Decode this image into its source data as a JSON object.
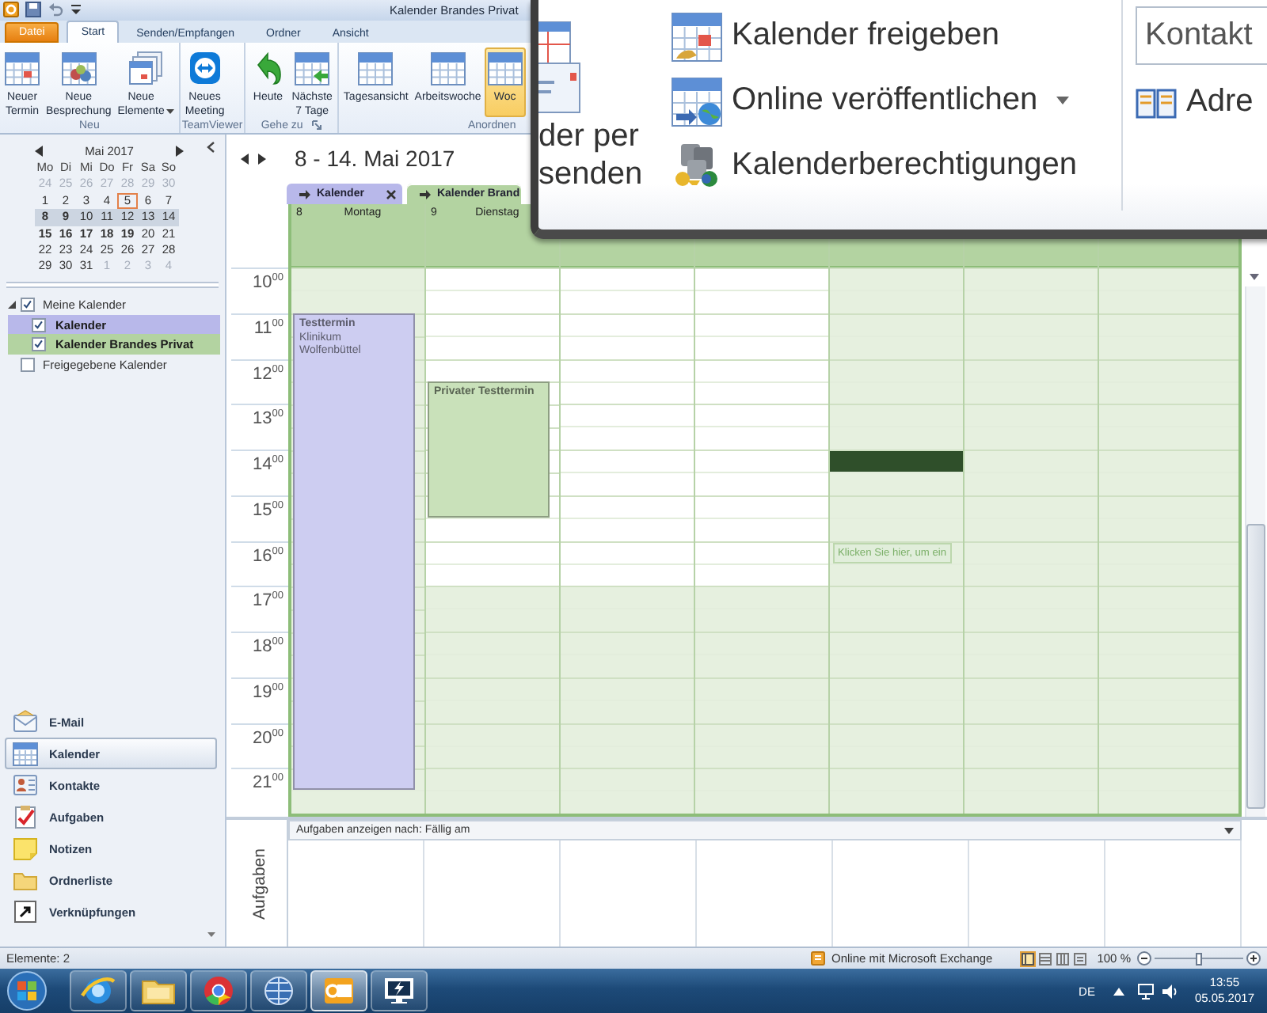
{
  "window": {
    "title": "Kalender Brandes Privat"
  },
  "ribbon_tabs": [
    {
      "label": "Datei",
      "kind": "file",
      "selected": false
    },
    {
      "label": "Start",
      "kind": "tab",
      "selected": true
    },
    {
      "label": "Senden/Empfangen",
      "kind": "tab",
      "selected": false
    },
    {
      "label": "Ordner",
      "kind": "tab",
      "selected": false
    },
    {
      "label": "Ansicht",
      "kind": "tab",
      "selected": false
    }
  ],
  "ribbon_groups": [
    {
      "label": "Neu",
      "launcher": false,
      "buttons": [
        {
          "kind": "new-appointment",
          "lines": [
            "Neuer",
            "Termin"
          ],
          "dropdown": false,
          "selected": false
        },
        {
          "kind": "new-meeting",
          "lines": [
            "Neue",
            "Besprechung"
          ],
          "dropdown": false,
          "selected": false
        },
        {
          "kind": "new-items",
          "lines": [
            "Neue",
            "Elemente"
          ],
          "dropdown": true,
          "selected": false
        }
      ]
    },
    {
      "label": "TeamViewer",
      "launcher": false,
      "buttons": [
        {
          "kind": "teamviewer-meeting",
          "lines": [
            "Neues",
            "Meeting"
          ],
          "dropdown": false,
          "selected": false
        }
      ]
    },
    {
      "label": "Gehe zu",
      "launcher": true,
      "buttons": [
        {
          "kind": "today",
          "lines": [
            "Heute"
          ],
          "dropdown": false,
          "selected": false
        },
        {
          "kind": "next-7-days",
          "lines": [
            "Nächste",
            "7 Tage"
          ],
          "dropdown": false,
          "selected": false
        }
      ]
    },
    {
      "label": "Anordnen",
      "launcher": false,
      "buttons": [
        {
          "kind": "day-view",
          "lines": [
            "Tagesansicht"
          ],
          "dropdown": false,
          "selected": false
        },
        {
          "kind": "work-week-view",
          "lines": [
            "Arbeitswoche"
          ],
          "dropdown": false,
          "selected": false
        },
        {
          "kind": "week-view",
          "lines": [
            "Woc"
          ],
          "dropdown": false,
          "selected": true
        }
      ]
    }
  ],
  "mini_calendar": {
    "month": "Mai 2017",
    "weekdays": [
      "Mo",
      "Di",
      "Mi",
      "Do",
      "Fr",
      "Sa",
      "So"
    ],
    "weeks": [
      {
        "selected": false,
        "days": [
          {
            "label": "24",
            "other_month": true,
            "bold": false,
            "today": false
          },
          {
            "label": "25",
            "other_month": true,
            "bold": false,
            "today": false
          },
          {
            "label": "26",
            "other_month": true,
            "bold": false,
            "today": false
          },
          {
            "label": "27",
            "other_month": true,
            "bold": false,
            "today": false
          },
          {
            "label": "28",
            "other_month": true,
            "bold": false,
            "today": false
          },
          {
            "label": "29",
            "other_month": true,
            "bold": false,
            "today": false
          },
          {
            "label": "30",
            "other_month": true,
            "bold": false,
            "today": false
          }
        ]
      },
      {
        "selected": false,
        "days": [
          {
            "label": "1",
            "other_month": false,
            "bold": false,
            "today": false
          },
          {
            "label": "2",
            "other_month": false,
            "bold": false,
            "today": false
          },
          {
            "label": "3",
            "other_month": false,
            "bold": false,
            "today": false
          },
          {
            "label": "4",
            "other_month": false,
            "bold": false,
            "today": false
          },
          {
            "label": "5",
            "other_month": false,
            "bold": false,
            "today": true
          },
          {
            "label": "6",
            "other_month": false,
            "bold": false,
            "today": false
          },
          {
            "label": "7",
            "other_month": false,
            "bold": false,
            "today": false
          }
        ]
      },
      {
        "selected": true,
        "days": [
          {
            "label": "8",
            "other_month": false,
            "bold": true,
            "today": false
          },
          {
            "label": "9",
            "other_month": false,
            "bold": true,
            "today": false
          },
          {
            "label": "10",
            "other_month": false,
            "bold": false,
            "today": false
          },
          {
            "label": "11",
            "other_month": false,
            "bold": false,
            "today": false
          },
          {
            "label": "12",
            "other_month": false,
            "bold": false,
            "today": false
          },
          {
            "label": "13",
            "other_month": false,
            "bold": false,
            "today": false
          },
          {
            "label": "14",
            "other_month": false,
            "bold": false,
            "today": false
          }
        ]
      },
      {
        "selected": false,
        "days": [
          {
            "label": "15",
            "other_month": false,
            "bold": true,
            "today": false
          },
          {
            "label": "16",
            "other_month": false,
            "bold": true,
            "today": false
          },
          {
            "label": "17",
            "other_month": false,
            "bold": true,
            "today": false
          },
          {
            "label": "18",
            "other_month": false,
            "bold": true,
            "today": false
          },
          {
            "label": "19",
            "other_month": false,
            "bold": true,
            "today": false
          },
          {
            "label": "20",
            "other_month": false,
            "bold": false,
            "today": false
          },
          {
            "label": "21",
            "other_month": false,
            "bold": false,
            "today": false
          }
        ]
      },
      {
        "selected": false,
        "days": [
          {
            "label": "22",
            "other_month": false,
            "bold": false,
            "today": false
          },
          {
            "label": "23",
            "other_month": false,
            "bold": false,
            "today": false
          },
          {
            "label": "24",
            "other_month": false,
            "bold": false,
            "today": false
          },
          {
            "label": "25",
            "other_month": false,
            "bold": false,
            "today": false
          },
          {
            "label": "26",
            "other_month": false,
            "bold": false,
            "today": false
          },
          {
            "label": "27",
            "other_month": false,
            "bold": false,
            "today": false
          },
          {
            "label": "28",
            "other_month": false,
            "bold": false,
            "today": false
          }
        ]
      },
      {
        "selected": false,
        "days": [
          {
            "label": "29",
            "other_month": false,
            "bold": false,
            "today": false
          },
          {
            "label": "30",
            "other_month": false,
            "bold": false,
            "today": false
          },
          {
            "label": "31",
            "other_month": false,
            "bold": false,
            "today": false
          },
          {
            "label": "1",
            "other_month": true,
            "bold": false,
            "today": false
          },
          {
            "label": "2",
            "other_month": true,
            "bold": false,
            "today": false
          },
          {
            "label": "3",
            "other_month": true,
            "bold": false,
            "today": false
          },
          {
            "label": "4",
            "other_month": true,
            "bold": false,
            "today": false
          }
        ]
      }
    ]
  },
  "folders": [
    {
      "label": "Meine Kalender",
      "expanded": true,
      "checked": true,
      "children": [
        {
          "label": "Kalender",
          "checked": true,
          "color": "#b8b8ea"
        },
        {
          "label": "Kalender Brandes Privat",
          "checked": true,
          "color": "#b3d3a1"
        }
      ]
    },
    {
      "label": "Freigegebene Kalender",
      "expanded": false,
      "checked": false
    }
  ],
  "navigation": [
    {
      "label": "E-Mail",
      "kind": "mail",
      "selected": false
    },
    {
      "label": "Kalender",
      "kind": "calendar",
      "selected": true
    },
    {
      "label": "Kontakte",
      "kind": "contacts",
      "selected": false
    },
    {
      "label": "Aufgaben",
      "kind": "tasks",
      "selected": false
    },
    {
      "label": "Notizen",
      "kind": "notes",
      "selected": false
    },
    {
      "label": "Ordnerliste",
      "kind": "folders",
      "selected": false
    },
    {
      "label": "Verknüpfungen",
      "kind": "shortcuts",
      "selected": false
    }
  ],
  "date_range": "8 - 14. Mai 2017",
  "calendar_tabs": [
    {
      "label": "Kalender",
      "color": "#b8b8ea",
      "selected": false,
      "closable": true
    },
    {
      "label": "Kalender Brand",
      "color": "#b3d3a1",
      "selected": true,
      "closable": false
    }
  ],
  "hours": [
    {
      "hour": "10",
      "minutes": "00",
      "work": true
    },
    {
      "hour": "11",
      "minutes": "00",
      "work": true
    },
    {
      "hour": "12",
      "minutes": "00",
      "work": true
    },
    {
      "hour": "13",
      "minutes": "00",
      "work": true
    },
    {
      "hour": "14",
      "minutes": "00",
      "work": true
    },
    {
      "hour": "15",
      "minutes": "00",
      "work": true
    },
    {
      "hour": "16",
      "minutes": "00",
      "work": true
    },
    {
      "hour": "17",
      "minutes": "00",
      "work": false
    },
    {
      "hour": "18",
      "minutes": "00",
      "work": false
    },
    {
      "hour": "19",
      "minutes": "00",
      "work": false
    },
    {
      "hour": "20",
      "minutes": "00",
      "work": false
    },
    {
      "hour": "21",
      "minutes": "00",
      "work": false
    }
  ],
  "columns": [
    {
      "number": "8",
      "weekday": "Montag",
      "shaded": true,
      "events": [
        {
          "title": "Testtermin",
          "location": "Klinikum Wolfenbüttel",
          "color": "#cdcdf1"
        }
      ],
      "slots": [
        {
          "kind": "free"
        },
        {
          "kind": "free"
        },
        {
          "kind": "busy"
        },
        {
          "kind": "busy"
        },
        {
          "kind": "busy"
        },
        {
          "kind": "busy"
        },
        {
          "kind": "busy"
        },
        {
          "kind": "busy"
        },
        {
          "kind": "busy"
        },
        {
          "kind": "busy"
        },
        {
          "kind": "busy"
        },
        {
          "kind": "busy"
        },
        {
          "kind": "busy"
        },
        {
          "kind": "busy"
        },
        {
          "kind": "busy"
        },
        {
          "kind": "busy"
        },
        {
          "kind": "busy"
        },
        {
          "kind": "busy"
        },
        {
          "kind": "busy"
        },
        {
          "kind": "busy"
        },
        {
          "kind": "busy"
        },
        {
          "kind": "busy"
        },
        {
          "kind": "busy"
        },
        {
          "kind": "free"
        }
      ]
    },
    {
      "number": "9",
      "weekday": "Dienstag",
      "shaded": false,
      "events": [
        {
          "title": "Privater Testtermin",
          "color": "#c9e1ba"
        }
      ],
      "slots": [
        {
          "kind": "free"
        },
        {
          "kind": "free"
        },
        {
          "kind": "free"
        },
        {
          "kind": "free"
        },
        {
          "kind": "free"
        },
        {
          "kind": "busy"
        },
        {
          "kind": "busy"
        },
        {
          "kind": "busy"
        },
        {
          "kind": "busy"
        },
        {
          "kind": "busy"
        },
        {
          "kind": "busy"
        },
        {
          "kind": "free"
        },
        {
          "kind": "free"
        },
        {
          "kind": "free"
        },
        {
          "kind": "free"
        },
        {
          "kind": "free"
        },
        {
          "kind": "free"
        },
        {
          "kind": "free"
        },
        {
          "kind": "free"
        },
        {
          "kind": "free"
        },
        {
          "kind": "free"
        },
        {
          "kind": "free"
        },
        {
          "kind": "free"
        },
        {
          "kind": "free"
        }
      ]
    },
    {
      "shaded": false
    },
    {
      "shaded": false
    },
    {
      "shaded": true,
      "hint": "Klicken Sie hier, um ein",
      "slots": [
        {
          "kind": "free"
        },
        {
          "kind": "free"
        },
        {
          "kind": "free"
        },
        {
          "kind": "free"
        },
        {
          "kind": "free"
        },
        {
          "kind": "free"
        },
        {
          "kind": "free"
        },
        {
          "kind": "free"
        },
        {
          "kind": "selected"
        },
        {
          "kind": "free"
        },
        {
          "kind": "free"
        },
        {
          "kind": "free"
        },
        {
          "kind": "hint"
        },
        {
          "kind": "free"
        },
        {
          "kind": "free"
        },
        {
          "kind": "free"
        },
        {
          "kind": "free"
        },
        {
          "kind": "free"
        },
        {
          "kind": "free"
        },
        {
          "kind": "free"
        },
        {
          "kind": "free"
        },
        {
          "kind": "free"
        },
        {
          "kind": "free"
        },
        {
          "kind": "free"
        }
      ]
    },
    {
      "shaded": true
    },
    {
      "shaded": true
    }
  ],
  "tasks": {
    "label": "Aufgaben",
    "sort_label": "Aufgaben anzeigen nach: Fällig am"
  },
  "zoom_window": {
    "email_lines": [
      "der per",
      "senden"
    ],
    "share_items": [
      {
        "label": "Kalender freigeben",
        "kind": "share",
        "dropdown": false
      },
      {
        "label": "Online veröffentlichen",
        "kind": "publish",
        "dropdown": true
      },
      {
        "label": "Kalenderberechtigungen",
        "kind": "permissions",
        "dropdown": false
      }
    ],
    "contact_search": {
      "placeholder": "Kontakt"
    },
    "address_book": "Adre"
  },
  "status_bar": {
    "items_count": "Elemente: 2",
    "connection": "Online mit Microsoft Exchange",
    "views": [
      {
        "kind": "normal",
        "selected": true
      },
      {
        "kind": "reading",
        "selected": false
      },
      {
        "kind": "compact",
        "selected": false
      },
      {
        "kind": "list",
        "selected": false
      }
    ],
    "zoom": "100 %",
    "zoom_slider": {
      "level": 0.5
    }
  },
  "taskbar": {
    "apps": [
      {
        "kind": "browser",
        "selected": false
      },
      {
        "kind": "explorer",
        "selected": false
      },
      {
        "kind": "chrome",
        "selected": false
      },
      {
        "kind": "globe",
        "selected": false
      },
      {
        "kind": "outlook",
        "selected": true
      },
      {
        "kind": "remote",
        "selected": false
      }
    ],
    "language": "DE",
    "time": "13:55",
    "date": "05.05.2017"
  }
}
